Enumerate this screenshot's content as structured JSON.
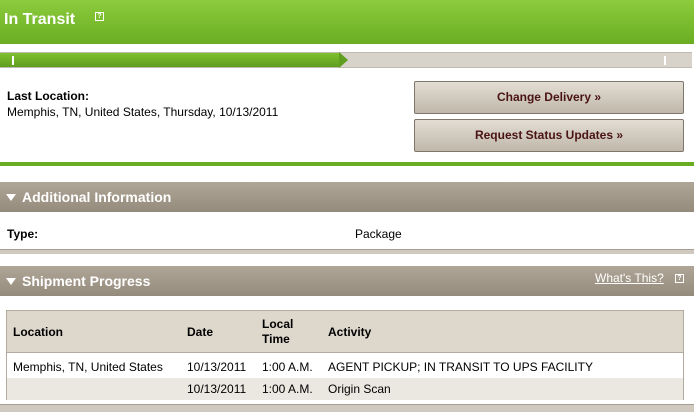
{
  "status": {
    "title": "In Transit",
    "help_icon_glyph": "?",
    "progress_fraction": 0.49,
    "accent_color": "#6aad23"
  },
  "location": {
    "label": "Last Location:",
    "value": "Memphis, TN, United States, Thursday, 10/13/2011"
  },
  "actions": {
    "change_delivery": "Change Delivery »",
    "request_status": "Request Status Updates »"
  },
  "additional_info": {
    "title": "Additional Information",
    "type_label": "Type:",
    "type_value": "Package"
  },
  "shipment_progress": {
    "title": "Shipment Progress",
    "whats_this": "What's This?",
    "columns": {
      "location": "Location",
      "date": "Date",
      "local_time_line1": "Local",
      "local_time_line2": "Time",
      "activity": "Activity"
    },
    "rows": [
      {
        "location": "Memphis, TN, United States",
        "date": "10/13/2011",
        "time": "1:00 A.M.",
        "activity": "AGENT PICKUP; IN TRANSIT TO UPS FACILITY"
      },
      {
        "location": "",
        "date": "10/13/2011",
        "time": "1:00 A.M.",
        "activity": "Origin Scan"
      }
    ]
  }
}
